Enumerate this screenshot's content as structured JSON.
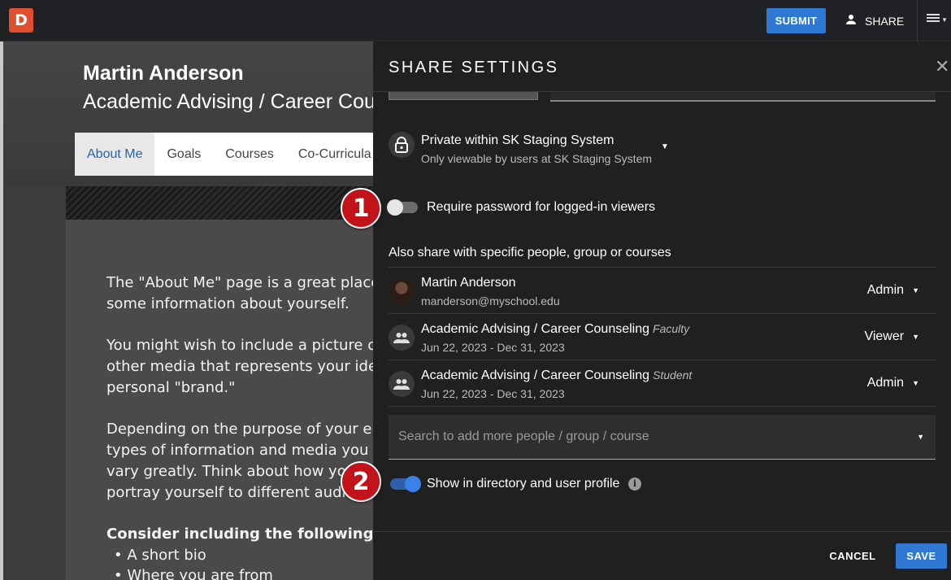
{
  "topbar": {
    "logo": "D",
    "submit_label": "SUBMIT",
    "share_label": "SHARE",
    "menu_icon": "hamburger-menu-icon"
  },
  "background_page": {
    "name": "Martin Anderson",
    "subtitle": "Academic Advising / Career Cou",
    "tabs": [
      "About Me",
      "Goals",
      "Courses",
      "Co-Curricula"
    ],
    "active_tab": "About Me",
    "paragraphs": [
      "The \"About Me\" page is a great place to",
      "some information about yourself.",
      "You might wish to include a picture of y",
      "other media that represents your ident",
      "personal \"brand.\"",
      "Depending on the purpose of your ePo",
      "types of information and media you pro",
      "vary greatly. Think about how you w",
      "portray yourself to different audien"
    ],
    "consider_heading": "Consider including the following:",
    "bullets": [
      "A short bio",
      "Where you are from"
    ]
  },
  "panel": {
    "title": "SHARE SETTINGS",
    "privacy": {
      "label": "Private within SK Staging System",
      "description": "Only viewable by users at SK Staging System"
    },
    "require_password": {
      "label": "Require password for logged-in viewers",
      "enabled": false
    },
    "also_share_label": "Also share with specific people, group or courses",
    "share_rows": [
      {
        "name": "Martin Anderson",
        "tag": "",
        "sub": "manderson@myschool.edu",
        "role": "Admin",
        "avatar": "user-photo"
      },
      {
        "name": "Academic Advising / Career Counseling",
        "tag": "Faculty",
        "sub": "Jun 22, 2023 - Dec 31, 2023",
        "role": "Viewer",
        "avatar": "group-icon"
      },
      {
        "name": "Academic Advising / Career Counseling",
        "tag": "Student",
        "sub": "Jun 22, 2023 - Dec 31, 2023",
        "role": "Admin",
        "avatar": "group-icon"
      }
    ],
    "search_placeholder": "Search to add more people / group / course",
    "show_in_directory": {
      "label": "Show in directory and user profile",
      "enabled": true
    },
    "cancel_label": "CANCEL",
    "save_label": "SAVE"
  },
  "markers": [
    "1",
    "2"
  ],
  "colors": {
    "accent_blue": "#2f78d4",
    "marker_red": "#c2121a",
    "logo_orange": "#e1502e",
    "panel_bg": "#202020",
    "toggle_on": "#3a82e8"
  }
}
